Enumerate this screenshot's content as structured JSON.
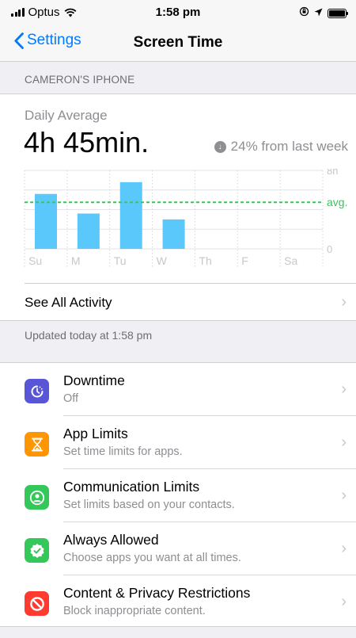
{
  "status_bar": {
    "carrier": "Optus",
    "time": "1:58 pm"
  },
  "nav": {
    "back_label": "Settings",
    "title": "Screen Time"
  },
  "device_header": "CAMERON'S IPHONE",
  "summary": {
    "daily_label": "Daily Average",
    "daily_value": "4h 45min.",
    "change_text": "24% from last week",
    "change_icon": "down-arrow-circle-icon"
  },
  "chart_data": {
    "type": "bar",
    "categories": [
      "Su",
      "M",
      "Tu",
      "W",
      "Th",
      "F",
      "Sa"
    ],
    "values": [
      5.6,
      3.6,
      6.8,
      3.0,
      null,
      null,
      null
    ],
    "unit": "h",
    "ylim": [
      0,
      8
    ],
    "y_ticks": [
      "8h",
      "0"
    ],
    "average_label": "avg.",
    "average_value": 4.75,
    "bar_color": "#5ac8fa",
    "average_color": "#34c759",
    "grid": true
  },
  "see_all_activity": "See All Activity",
  "updated_text": "Updated today at 1:58 pm",
  "settings": [
    {
      "title": "Downtime",
      "subtitle": "Off",
      "icon": "downtime-icon",
      "color": "#5856d6"
    },
    {
      "title": "App Limits",
      "subtitle": "Set time limits for apps.",
      "icon": "hourglass-icon",
      "color": "#ff9500"
    },
    {
      "title": "Communication Limits",
      "subtitle": "Set limits based on your contacts.",
      "icon": "contact-icon",
      "color": "#34c759"
    },
    {
      "title": "Always Allowed",
      "subtitle": "Choose apps you want at all times.",
      "icon": "checkmark-badge-icon",
      "color": "#34c759"
    },
    {
      "title": "Content & Privacy Restrictions",
      "subtitle": "Block inappropriate content.",
      "icon": "restriction-icon",
      "color": "#ff3b30"
    }
  ]
}
